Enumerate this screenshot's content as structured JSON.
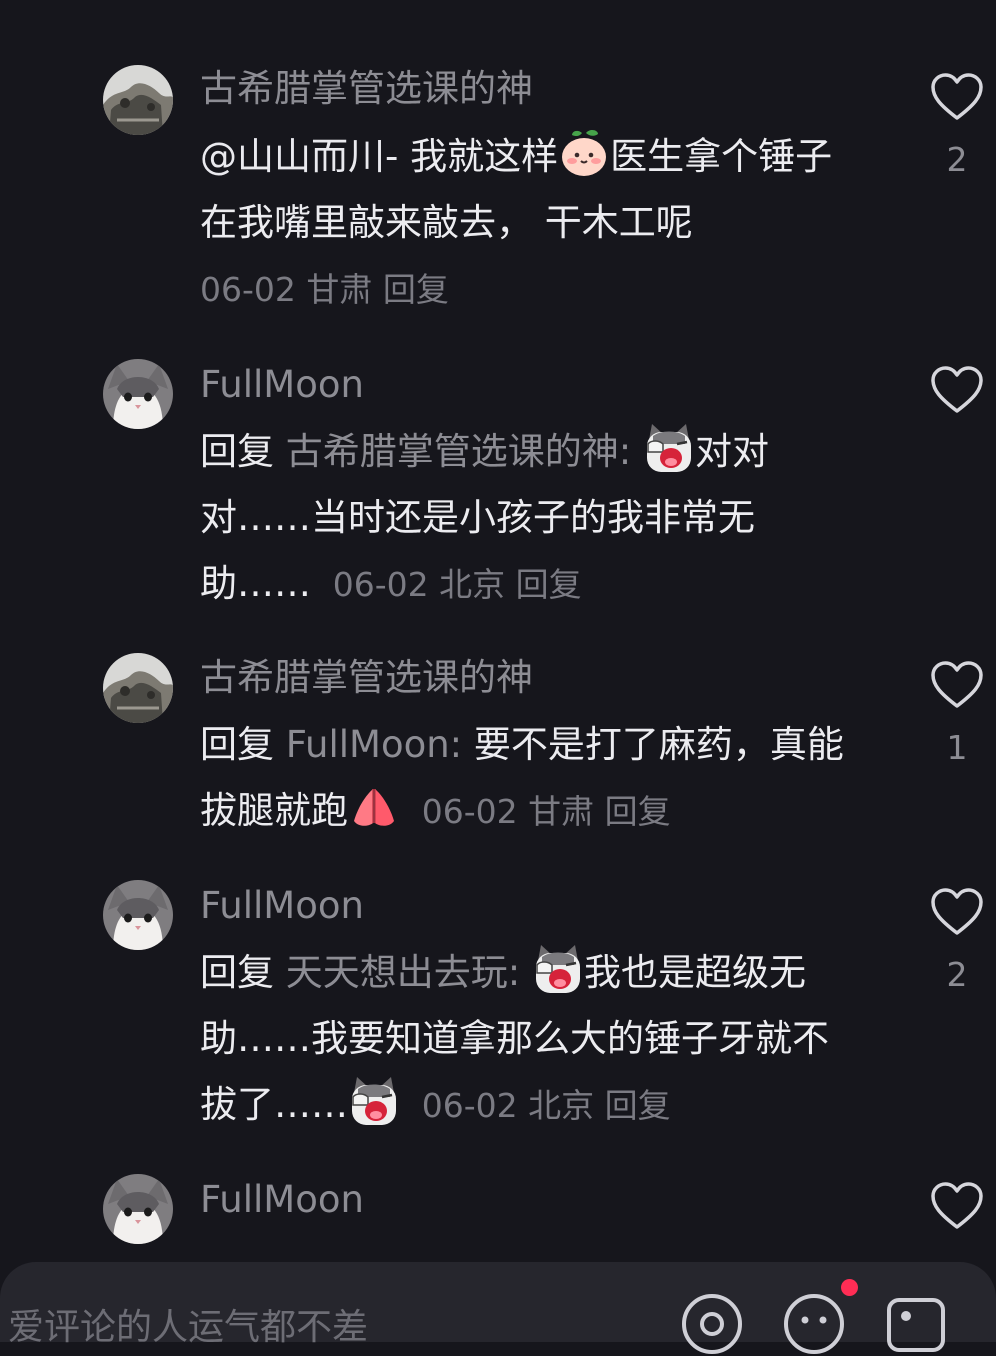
{
  "comments": [
    {
      "author": "古希腊掌管选课的神",
      "avatar": "stone-sculpture-avatar",
      "mention": "@山山而川-",
      "text_a": " 我就这样",
      "emoji_a": "peach-face-emoji",
      "text_b": "医生拿个锤子在我嘴里敲来敲去， 干木工呢",
      "date": "06-02",
      "location": "甘肃",
      "reply_label": "回复",
      "likes": "2"
    },
    {
      "author": "FullMoon",
      "avatar": "grey-cat-avatar",
      "reply_prefix": "回复 ",
      "reply_target": "古希腊掌管选课的神: ",
      "emoji_a": "crying-cat-emoji",
      "text_a": "对对对……当时还是小孩子的我非常无助……",
      "date": "06-02",
      "location": "北京",
      "reply_label": "回复",
      "likes": ""
    },
    {
      "author": "古希腊掌管选课的神",
      "avatar": "stone-sculpture-avatar",
      "reply_prefix": "回复 ",
      "reply_target": "FullMoon: ",
      "text_a": "要不是打了麻药，真能拔腿就跑",
      "emoji_a": "praying-hands-emoji",
      "date": "06-02",
      "location": "甘肃",
      "reply_label": "回复",
      "likes": "1"
    },
    {
      "author": "FullMoon",
      "avatar": "grey-cat-avatar",
      "reply_prefix": "回复 ",
      "reply_target": "天天想出去玩: ",
      "emoji_a": "crying-cat-emoji",
      "text_a": "我也是超级无助……我要知道拿那么大的锤子牙就不拔了……",
      "emoji_b": "crying-cat-emoji",
      "date": "06-02",
      "location": "北京",
      "reply_label": "回复",
      "likes": "2"
    },
    {
      "author": "FullMoon",
      "avatar": "grey-cat-avatar",
      "likes": ""
    }
  ],
  "bottom_bar": {
    "placeholder": "爱评论的人运气都不差",
    "icons": [
      "at-icon",
      "emoji-icon",
      "image-icon"
    ],
    "notification_color": "#ff2d55"
  },
  "colors": {
    "background": "#16161c",
    "primary_text": "#ececf0",
    "secondary_text": "#8d8d94"
  }
}
